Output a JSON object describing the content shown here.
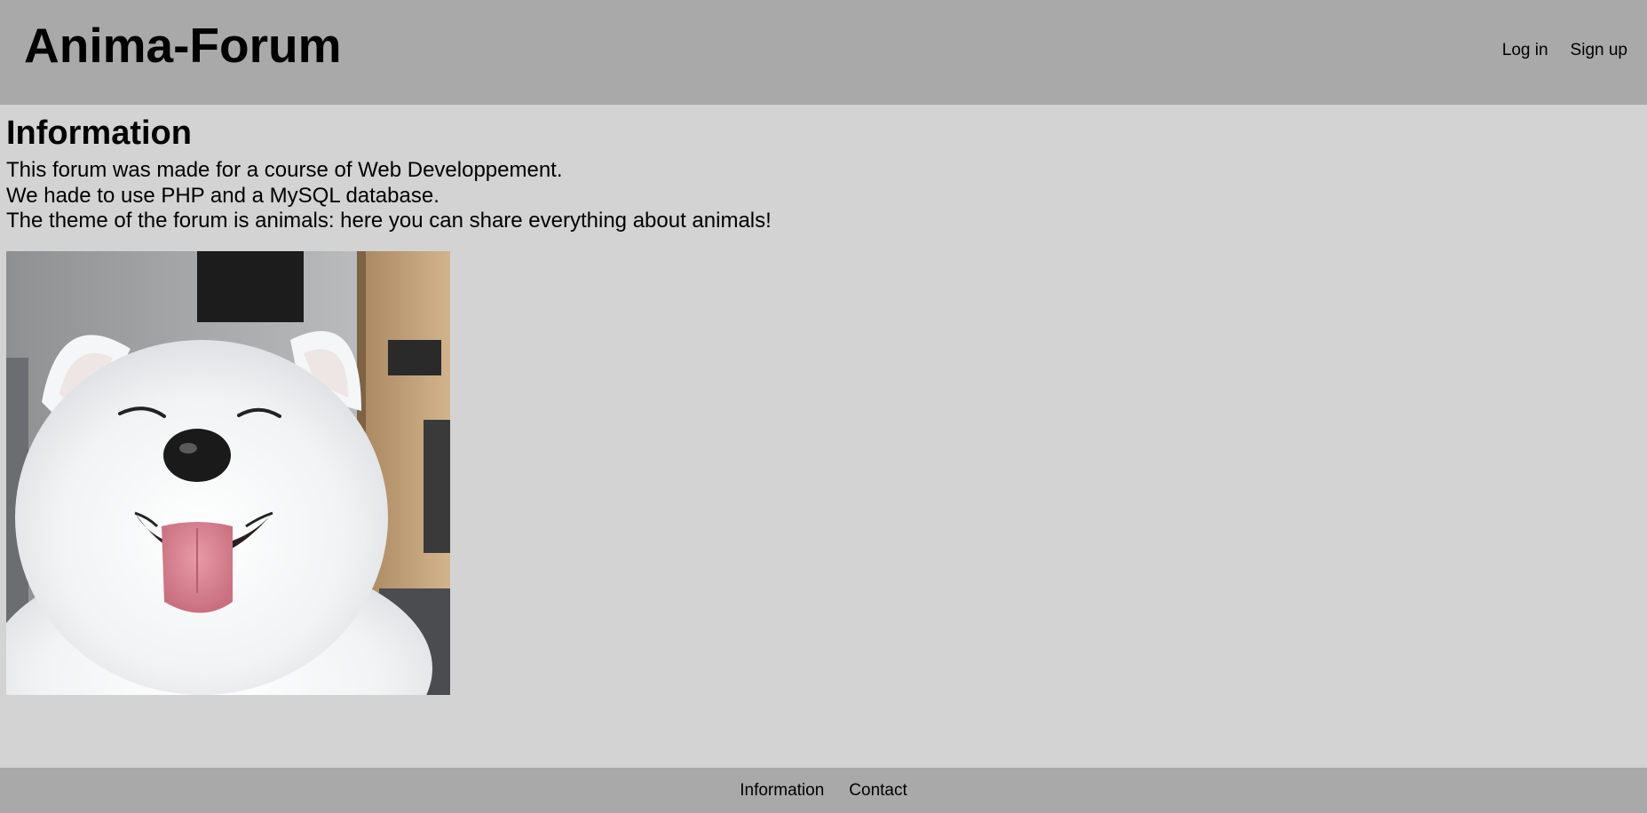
{
  "header": {
    "site_title": "Anima-Forum",
    "auth_links": [
      "Log in",
      "Sign up"
    ]
  },
  "main": {
    "title": "Information",
    "paragraphs": [
      "This forum was made for a course of Web Developpement.",
      "We hade to use PHP and a MySQL database.",
      "The theme of the forum is animals: here you can share everything about animals!"
    ],
    "image": "smiling-samoyed-dog-photo"
  },
  "footer": {
    "links": [
      "Information",
      "Contact"
    ]
  },
  "colors": {
    "header_bg": "#a9a9a9",
    "page_bg": "#d3d3d3",
    "footer_bg": "#a9a9a9",
    "text": "#000000"
  }
}
